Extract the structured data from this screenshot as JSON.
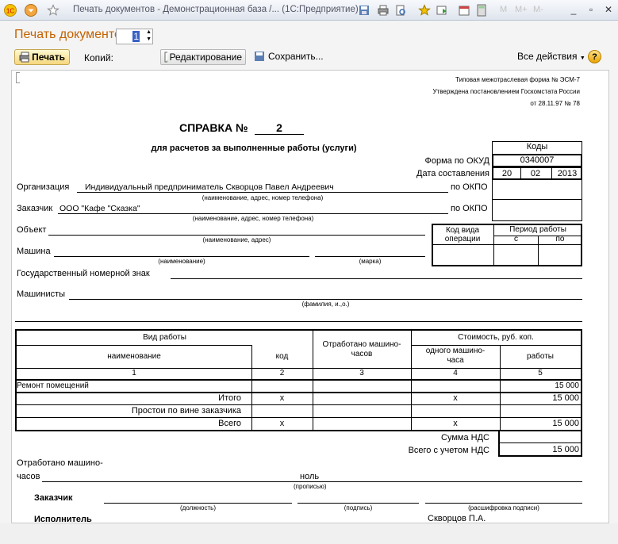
{
  "window": {
    "title": "Печать документов - Демонстрационная база /...   (1С:Предприятие)",
    "m_labels": [
      "M",
      "M+",
      "M-"
    ],
    "icons": [
      "1c-logo-icon",
      "menu-arrow-icon",
      "star-icon",
      "save-icon",
      "print-icon",
      "preview-icon",
      "favorites-icon",
      "history-icon",
      "calendar-icon",
      "calculator-icon",
      "minimize-icon",
      "restore-icon",
      "close-icon"
    ]
  },
  "header": {
    "title": "Печать документов",
    "print_button": "Печать",
    "copies_label": "Копий:",
    "copies_value": "1",
    "edit_button": "Редактирование",
    "save_button": "Сохранить...",
    "all_actions": "Все действия",
    "help": "?"
  },
  "doc": {
    "form_note": [
      "Типовая межотраслевая форма № ЭСМ-7",
      "Утверждена постановлением Госкомстата России",
      "от 28.11.97 № 78"
    ],
    "title_prefix": "СПРАВКА №",
    "number": "2",
    "subtitle": "для расчетов за выполненные работы (услуги)",
    "codes_header": "Коды",
    "okud_label": "Форма по ОКУД",
    "okud_value": "0340007",
    "date_label": "Дата составления",
    "date": {
      "day": "20",
      "month": "02",
      "year": "2013"
    },
    "org_label": "Организация",
    "org_value": "Индивидуальный предприниматель Скворцов Павел Андреевич",
    "org_hint": "(наименование, адрес, номер телефона)",
    "okpo_label": "по ОКПО",
    "customer_label": "Заказчик",
    "customer_value": "ООО \"Кафе \"Сказка\"",
    "customer_hint": "(наименование, адрес, номер телефона)",
    "object_label": "Объект",
    "object_hint": "(наименование, адрес)",
    "machine_label": "Машина",
    "machine_hint": "(наименование)",
    "brand_hint": "(марка)",
    "op_code_label": "Код вида операции",
    "period_label": "Период работы",
    "period_from": "с",
    "period_to": "по",
    "plate_label": "Государственный номерной знак",
    "drivers_label": "Машинисты",
    "drivers_hint": "(фамилия, и.,о.)",
    "table": {
      "h_work": "Вид работы",
      "h_hours": "Отработано машино-часов",
      "h_cost": "Стоимость, руб. коп.",
      "h_name": "наименование",
      "h_code": "код",
      "h_one": "одного машино-часа",
      "h_works": "работы",
      "nums": [
        "1",
        "2",
        "3",
        "4",
        "5"
      ],
      "row_name": "Ремонт помещений",
      "row_total": "15 000"
    },
    "totals": {
      "itogo_label": "Итого",
      "itogo_value": "15 000",
      "x": "x",
      "downtime_label": "Простои по вине заказчика",
      "vsego_label": "Всего",
      "vsego_value": "15 000",
      "vat_label": "Сумма НДС",
      "total_vat_label": "Всего с учетом НДС",
      "total_vat_value": "15 000"
    },
    "hours_worked_label_1": "Отработано машино-",
    "hours_worked_label_2": "часов",
    "hours_worked_value": "ноль",
    "in_words": "(прописью)",
    "customer_sign_label": "Заказчик",
    "position_hint": "(должность)",
    "signature_hint": "(подпись)",
    "decode_hint": "(расшифровка подписи)",
    "executor_label": "Исполнитель",
    "executor_name": "Скворцов П.А."
  }
}
